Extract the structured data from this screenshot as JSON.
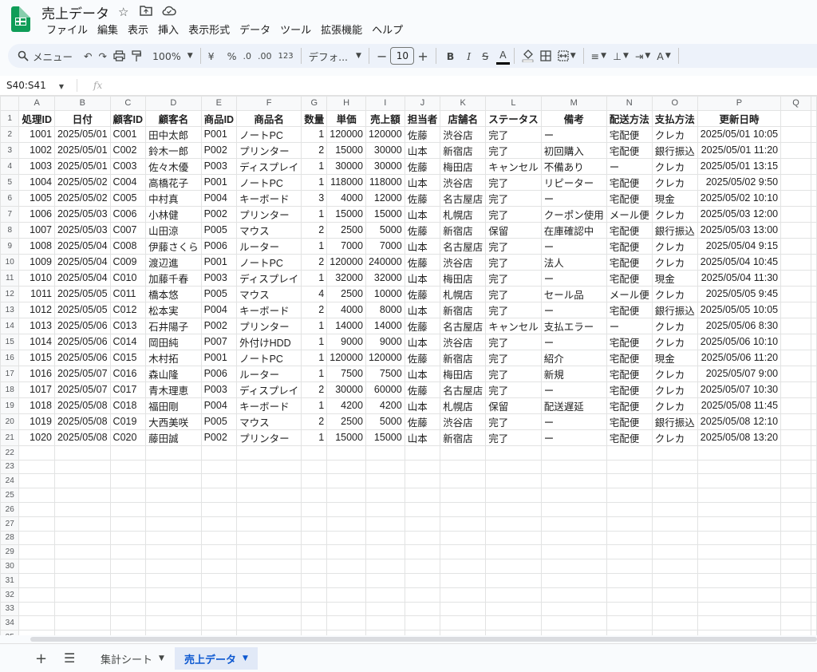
{
  "app": {
    "title": "売上データ",
    "star_icon": "star-icon",
    "move_icon": "folder-icon",
    "cloud_icon": "cloud-icon"
  },
  "menu": [
    "ファイル",
    "編集",
    "表示",
    "挿入",
    "表示形式",
    "データ",
    "ツール",
    "拡張機能",
    "ヘルプ"
  ],
  "toolbar": {
    "search_label": "メニュー",
    "zoom": "100%",
    "currency": "¥",
    "percent": "%",
    "dec_decrease": ".0",
    "dec_increase": ".00",
    "number_format": "123",
    "font": "デフォ...",
    "font_size": "10",
    "bold": "B",
    "italic": "I",
    "strike": "S",
    "text_color": "A"
  },
  "formula_bar": {
    "name_box": "S40:S41",
    "fx": "fx"
  },
  "columns": [
    "A",
    "B",
    "C",
    "D",
    "E",
    "F",
    "G",
    "H",
    "I",
    "J",
    "K",
    "L",
    "M",
    "N",
    "O",
    "P",
    "Q"
  ],
  "table": {
    "header": [
      "処理ID",
      "日付",
      "顧客ID",
      "顧客名",
      "商品ID",
      "商品名",
      "数量",
      "単価",
      "売上額",
      "担当者",
      "店舗名",
      "ステータス",
      "備考",
      "配送方法",
      "支払方法",
      "更新日時"
    ],
    "rows": [
      [
        "1001",
        "2025/05/01",
        "C001",
        "田中太郎",
        "P001",
        "ノートPC",
        "1",
        "120000",
        "120000",
        "佐藤",
        "渋谷店",
        "完了",
        "ー",
        "宅配便",
        "クレカ",
        "2025/05/01 10:05"
      ],
      [
        "1002",
        "2025/05/01",
        "C002",
        "鈴木一郎",
        "P002",
        "プリンター",
        "2",
        "15000",
        "30000",
        "山本",
        "新宿店",
        "完了",
        "初回購入",
        "宅配便",
        "銀行振込",
        "2025/05/01 11:20"
      ],
      [
        "1003",
        "2025/05/01",
        "C003",
        "佐々木優",
        "P003",
        "ディスプレイ",
        "1",
        "30000",
        "30000",
        "佐藤",
        "梅田店",
        "キャンセル",
        "不備あり",
        "ー",
        "クレカ",
        "2025/05/01 13:15"
      ],
      [
        "1004",
        "2025/05/02",
        "C004",
        "高橋花子",
        "P001",
        "ノートPC",
        "1",
        "118000",
        "118000",
        "山本",
        "渋谷店",
        "完了",
        "リピーター",
        "宅配便",
        "クレカ",
        "2025/05/02 9:50"
      ],
      [
        "1005",
        "2025/05/02",
        "C005",
        "中村真",
        "P004",
        "キーボード",
        "3",
        "4000",
        "12000",
        "佐藤",
        "名古屋店",
        "完了",
        "ー",
        "宅配便",
        "現金",
        "2025/05/02 10:10"
      ],
      [
        "1006",
        "2025/05/03",
        "C006",
        "小林健",
        "P002",
        "プリンター",
        "1",
        "15000",
        "15000",
        "山本",
        "札幌店",
        "完了",
        "クーポン使用",
        "メール便",
        "クレカ",
        "2025/05/03 12:00"
      ],
      [
        "1007",
        "2025/05/03",
        "C007",
        "山田涼",
        "P005",
        "マウス",
        "2",
        "2500",
        "5000",
        "佐藤",
        "新宿店",
        "保留",
        "在庫確認中",
        "宅配便",
        "銀行振込",
        "2025/05/03 13:00"
      ],
      [
        "1008",
        "2025/05/04",
        "C008",
        "伊藤さくら",
        "P006",
        "ルーター",
        "1",
        "7000",
        "7000",
        "山本",
        "名古屋店",
        "完了",
        "ー",
        "宅配便",
        "クレカ",
        "2025/05/04 9:15"
      ],
      [
        "1009",
        "2025/05/04",
        "C009",
        "渡辺進",
        "P001",
        "ノートPC",
        "2",
        "120000",
        "240000",
        "佐藤",
        "渋谷店",
        "完了",
        "法人",
        "宅配便",
        "クレカ",
        "2025/05/04 10:45"
      ],
      [
        "1010",
        "2025/05/04",
        "C010",
        "加藤千春",
        "P003",
        "ディスプレイ",
        "1",
        "32000",
        "32000",
        "山本",
        "梅田店",
        "完了",
        "ー",
        "宅配便",
        "現金",
        "2025/05/04 11:30"
      ],
      [
        "1011",
        "2025/05/05",
        "C011",
        "橋本悠",
        "P005",
        "マウス",
        "4",
        "2500",
        "10000",
        "佐藤",
        "札幌店",
        "完了",
        "セール品",
        "メール便",
        "クレカ",
        "2025/05/05 9:45"
      ],
      [
        "1012",
        "2025/05/05",
        "C012",
        "松本実",
        "P004",
        "キーボード",
        "2",
        "4000",
        "8000",
        "山本",
        "新宿店",
        "完了",
        "ー",
        "宅配便",
        "銀行振込",
        "2025/05/05 10:05"
      ],
      [
        "1013",
        "2025/05/06",
        "C013",
        "石井陽子",
        "P002",
        "プリンター",
        "1",
        "14000",
        "14000",
        "佐藤",
        "名古屋店",
        "キャンセル",
        "支払エラー",
        "ー",
        "クレカ",
        "2025/05/06 8:30"
      ],
      [
        "1014",
        "2025/05/06",
        "C014",
        "岡田純",
        "P007",
        "外付けHDD",
        "1",
        "9000",
        "9000",
        "山本",
        "渋谷店",
        "完了",
        "ー",
        "宅配便",
        "クレカ",
        "2025/05/06 10:10"
      ],
      [
        "1015",
        "2025/05/06",
        "C015",
        "木村拓",
        "P001",
        "ノートPC",
        "1",
        "120000",
        "120000",
        "佐藤",
        "新宿店",
        "完了",
        "紹介",
        "宅配便",
        "現金",
        "2025/05/06 11:20"
      ],
      [
        "1016",
        "2025/05/07",
        "C016",
        "森山隆",
        "P006",
        "ルーター",
        "1",
        "7500",
        "7500",
        "山本",
        "梅田店",
        "完了",
        "新規",
        "宅配便",
        "クレカ",
        "2025/05/07 9:00"
      ],
      [
        "1017",
        "2025/05/07",
        "C017",
        "青木理恵",
        "P003",
        "ディスプレイ",
        "2",
        "30000",
        "60000",
        "佐藤",
        "名古屋店",
        "完了",
        "ー",
        "宅配便",
        "クレカ",
        "2025/05/07 10:30"
      ],
      [
        "1018",
        "2025/05/08",
        "C018",
        "福田剛",
        "P004",
        "キーボード",
        "1",
        "4200",
        "4200",
        "山本",
        "札幌店",
        "保留",
        "配送遅延",
        "宅配便",
        "クレカ",
        "2025/05/08 11:45"
      ],
      [
        "1019",
        "2025/05/08",
        "C019",
        "大西美咲",
        "P005",
        "マウス",
        "2",
        "2500",
        "5000",
        "佐藤",
        "渋谷店",
        "完了",
        "ー",
        "宅配便",
        "銀行振込",
        "2025/05/08 12:10"
      ],
      [
        "1020",
        "2025/05/08",
        "C020",
        "藤田誠",
        "P002",
        "プリンター",
        "1",
        "15000",
        "15000",
        "山本",
        "新宿店",
        "完了",
        "ー",
        "宅配便",
        "クレカ",
        "2025/05/08 13:20"
      ]
    ],
    "row_count": 35
  },
  "tabs": [
    {
      "label": "集計シート",
      "active": false
    },
    {
      "label": "売上データ",
      "active": true
    }
  ],
  "colors": {
    "accent": "#0b57d0",
    "active_tab_bg": "#e1e9f7",
    "sheets_green": "#0f9d58"
  }
}
